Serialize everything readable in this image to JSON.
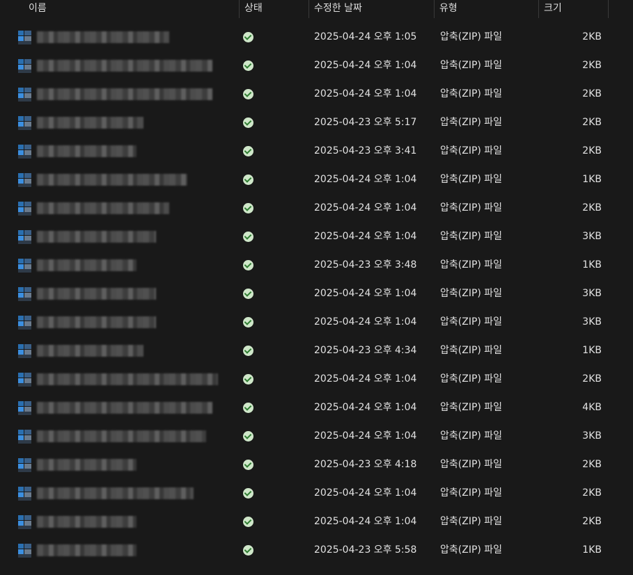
{
  "columns": {
    "name": "이름",
    "status": "상태",
    "date": "수정한 날짜",
    "type": "유형",
    "size": "크기"
  },
  "rows": [
    {
      "date": "2025-04-24 오후 1:05",
      "type": "압축(ZIP) 파일",
      "size": "2KB",
      "name_w": 190
    },
    {
      "date": "2025-04-24 오후 1:04",
      "type": "압축(ZIP) 파일",
      "size": "2KB",
      "name_w": 252
    },
    {
      "date": "2025-04-24 오후 1:04",
      "type": "압축(ZIP) 파일",
      "size": "2KB",
      "name_w": 252
    },
    {
      "date": "2025-04-23 오후 5:17",
      "type": "압축(ZIP) 파일",
      "size": "2KB",
      "name_w": 153
    },
    {
      "date": "2025-04-23 오후 3:41",
      "type": "압축(ZIP) 파일",
      "size": "2KB",
      "name_w": 143
    },
    {
      "date": "2025-04-24 오후 1:04",
      "type": "압축(ZIP) 파일",
      "size": "1KB",
      "name_w": 216
    },
    {
      "date": "2025-04-24 오후 1:04",
      "type": "압축(ZIP) 파일",
      "size": "2KB",
      "name_w": 190
    },
    {
      "date": "2025-04-24 오후 1:04",
      "type": "압축(ZIP) 파일",
      "size": "3KB",
      "name_w": 171
    },
    {
      "date": "2025-04-23 오후 3:48",
      "type": "압축(ZIP) 파일",
      "size": "1KB",
      "name_w": 143
    },
    {
      "date": "2025-04-24 오후 1:04",
      "type": "압축(ZIP) 파일",
      "size": "3KB",
      "name_w": 171
    },
    {
      "date": "2025-04-24 오후 1:04",
      "type": "압축(ZIP) 파일",
      "size": "3KB",
      "name_w": 171
    },
    {
      "date": "2025-04-23 오후 4:34",
      "type": "압축(ZIP) 파일",
      "size": "1KB",
      "name_w": 153
    },
    {
      "date": "2025-04-24 오후 1:04",
      "type": "압축(ZIP) 파일",
      "size": "2KB",
      "name_w": 260
    },
    {
      "date": "2025-04-24 오후 1:04",
      "type": "압축(ZIP) 파일",
      "size": "4KB",
      "name_w": 252
    },
    {
      "date": "2025-04-24 오후 1:04",
      "type": "압축(ZIP) 파일",
      "size": "3KB",
      "name_w": 243
    },
    {
      "date": "2025-04-23 오후 4:18",
      "type": "압축(ZIP) 파일",
      "size": "2KB",
      "name_w": 143
    },
    {
      "date": "2025-04-24 오후 1:04",
      "type": "압축(ZIP) 파일",
      "size": "2KB",
      "name_w": 225
    },
    {
      "date": "2025-04-24 오후 1:04",
      "type": "압축(ZIP) 파일",
      "size": "2KB",
      "name_w": 143
    },
    {
      "date": "2025-04-23 오후 5:58",
      "type": "압축(ZIP) 파일",
      "size": "1KB",
      "name_w": 143
    }
  ],
  "icons": {
    "file": "zip-file-icon",
    "status": "synced-check-icon"
  },
  "colors": {
    "background": "#191919",
    "text": "#e2e2e2",
    "status_green": "#2f7d32"
  }
}
